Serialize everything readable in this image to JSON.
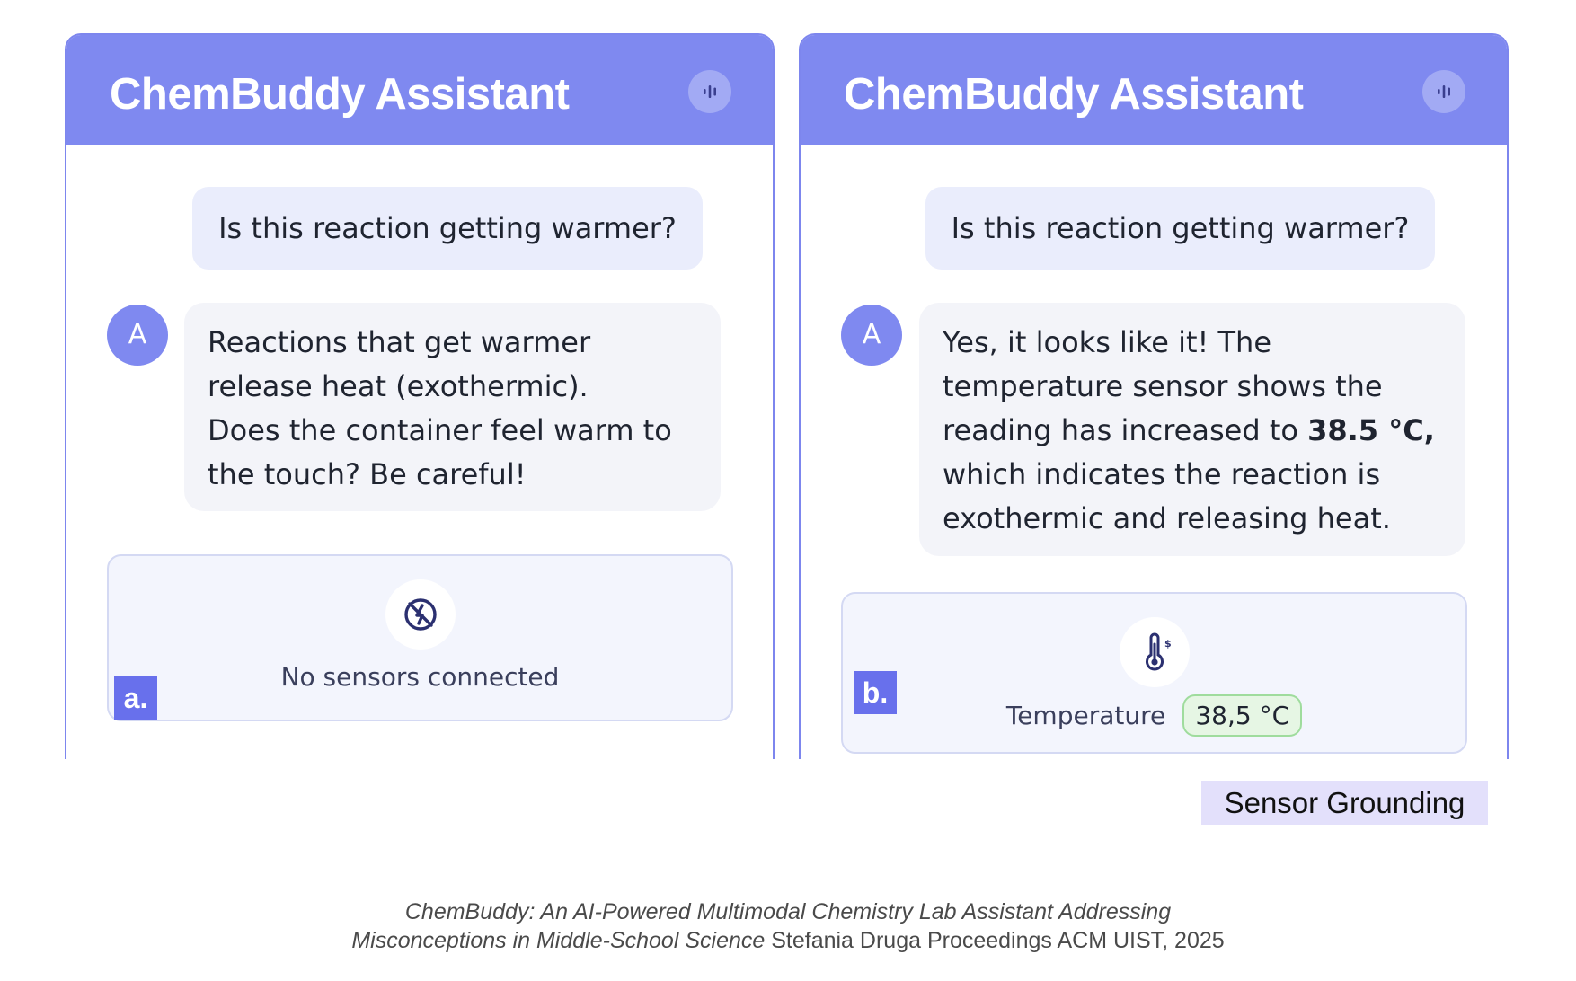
{
  "panels": [
    {
      "title": "ChemBuddy Assistant",
      "user_message": "Is this reaction getting warmer?",
      "avatar": "A",
      "response_lines": [
        "Reactions that get warmer",
        "release heat (exothermic).",
        "Does the container feel warm to",
        "the touch? Be careful!"
      ],
      "sensor_icon": "sensor-off-icon",
      "sensor_status": "No sensors connected",
      "tag": "a."
    },
    {
      "title": "ChemBuddy Assistant",
      "user_message": "Is this reaction getting warmer?",
      "avatar": "A",
      "response_lines": [
        "Yes, it looks like it! The",
        "temperature sensor shows the",
        "reading has increased to ",
        "which indicates the reaction is",
        "exothermic and releasing heat."
      ],
      "response_highlight": "38.5 °C,",
      "sensor_icon": "thermometer-icon",
      "sensor_name": "Temperature",
      "sensor_value": "38,5 °C",
      "tag": "b."
    }
  ],
  "feature_label": "Sensor Grounding",
  "caption": {
    "title_line1": "ChemBuddy: An AI-Powered Multimodal Chemistry Lab Assistant Addressing",
    "title_line2": "Misconceptions in Middle-School Science",
    "author": " Stefania Druga",
    "venue": "  Proceedings ACM UIST, 2025"
  },
  "colors": {
    "header": "#7f89f0",
    "accent": "#6870ec",
    "user_bubble": "#eaedfc",
    "bot_bubble": "#f3f4f9",
    "sensor_value_bg": "#e6f6e4",
    "label_bg": "#e3e0fb"
  }
}
